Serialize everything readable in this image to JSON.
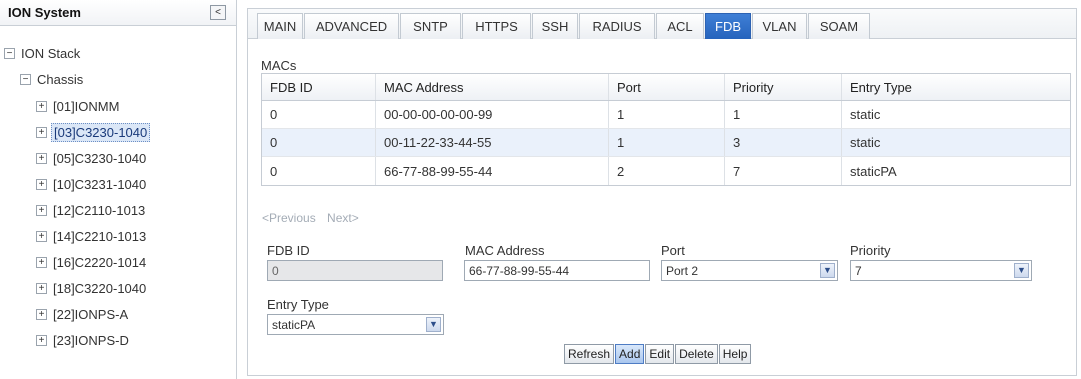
{
  "tree": {
    "title": "ION System",
    "collapse_glyph": "<",
    "root": {
      "toggle": "−",
      "label": "ION Stack"
    },
    "chassis": {
      "toggle": "−",
      "label": "Chassis"
    },
    "items": [
      {
        "toggle": "+",
        "label": "[01]IONMM"
      },
      {
        "toggle": "+",
        "label": "[03]C3230-1040"
      },
      {
        "toggle": "+",
        "label": "[05]C3230-1040"
      },
      {
        "toggle": "+",
        "label": "[10]C3231-1040"
      },
      {
        "toggle": "+",
        "label": "[12]C2110-1013"
      },
      {
        "toggle": "+",
        "label": "[14]C2210-1013"
      },
      {
        "toggle": "+",
        "label": "[16]C2220-1014"
      },
      {
        "toggle": "+",
        "label": "[18]C3220-1040"
      },
      {
        "toggle": "+",
        "label": "[22]IONPS-A"
      },
      {
        "toggle": "+",
        "label": "[23]IONPS-D"
      }
    ],
    "selected_index": 1
  },
  "tabs": [
    "MAIN",
    "ADVANCED",
    "SNTP",
    "HTTPS",
    "SSH",
    "RADIUS",
    "ACL",
    "FDB",
    "VLAN",
    "SOAM"
  ],
  "active_tab": "FDB",
  "macs": {
    "section_label": "MACs",
    "columns": [
      "FDB ID",
      "MAC Address",
      "Port",
      "Priority",
      "Entry Type"
    ],
    "rows": [
      [
        "0",
        "00-00-00-00-00-99",
        "1",
        "1",
        "static"
      ],
      [
        "0",
        "00-11-22-33-44-55",
        "1",
        "3",
        "static"
      ],
      [
        "0",
        "66-77-88-99-55-44",
        "2",
        "7",
        "staticPA"
      ]
    ]
  },
  "pager": {
    "previous": "<Previous",
    "next": "Next>"
  },
  "form": {
    "fdb_id_label": "FDB ID",
    "fdb_id_value": "0",
    "mac_label": "MAC Address",
    "mac_value": "66-77-88-99-55-44",
    "port_label": "Port",
    "port_value": "Port 2",
    "priority_label": "Priority",
    "priority_value": "7",
    "entry_type_label": "Entry Type",
    "entry_type_value": "staticPA"
  },
  "buttons": {
    "refresh": "Refresh",
    "add": "Add",
    "edit": "Edit",
    "delete": "Delete",
    "help": "Help"
  },
  "colors": {
    "active_tab": "#2f6fcd",
    "selected_row": "#eaf1fb",
    "selected_tree_item": "#dbe7f7"
  },
  "icons": {
    "expand": "plus-icon",
    "collapse": "minus-icon",
    "dropdown": "chevron-down-icon",
    "panel_collapse": "chevron-left-icon"
  }
}
